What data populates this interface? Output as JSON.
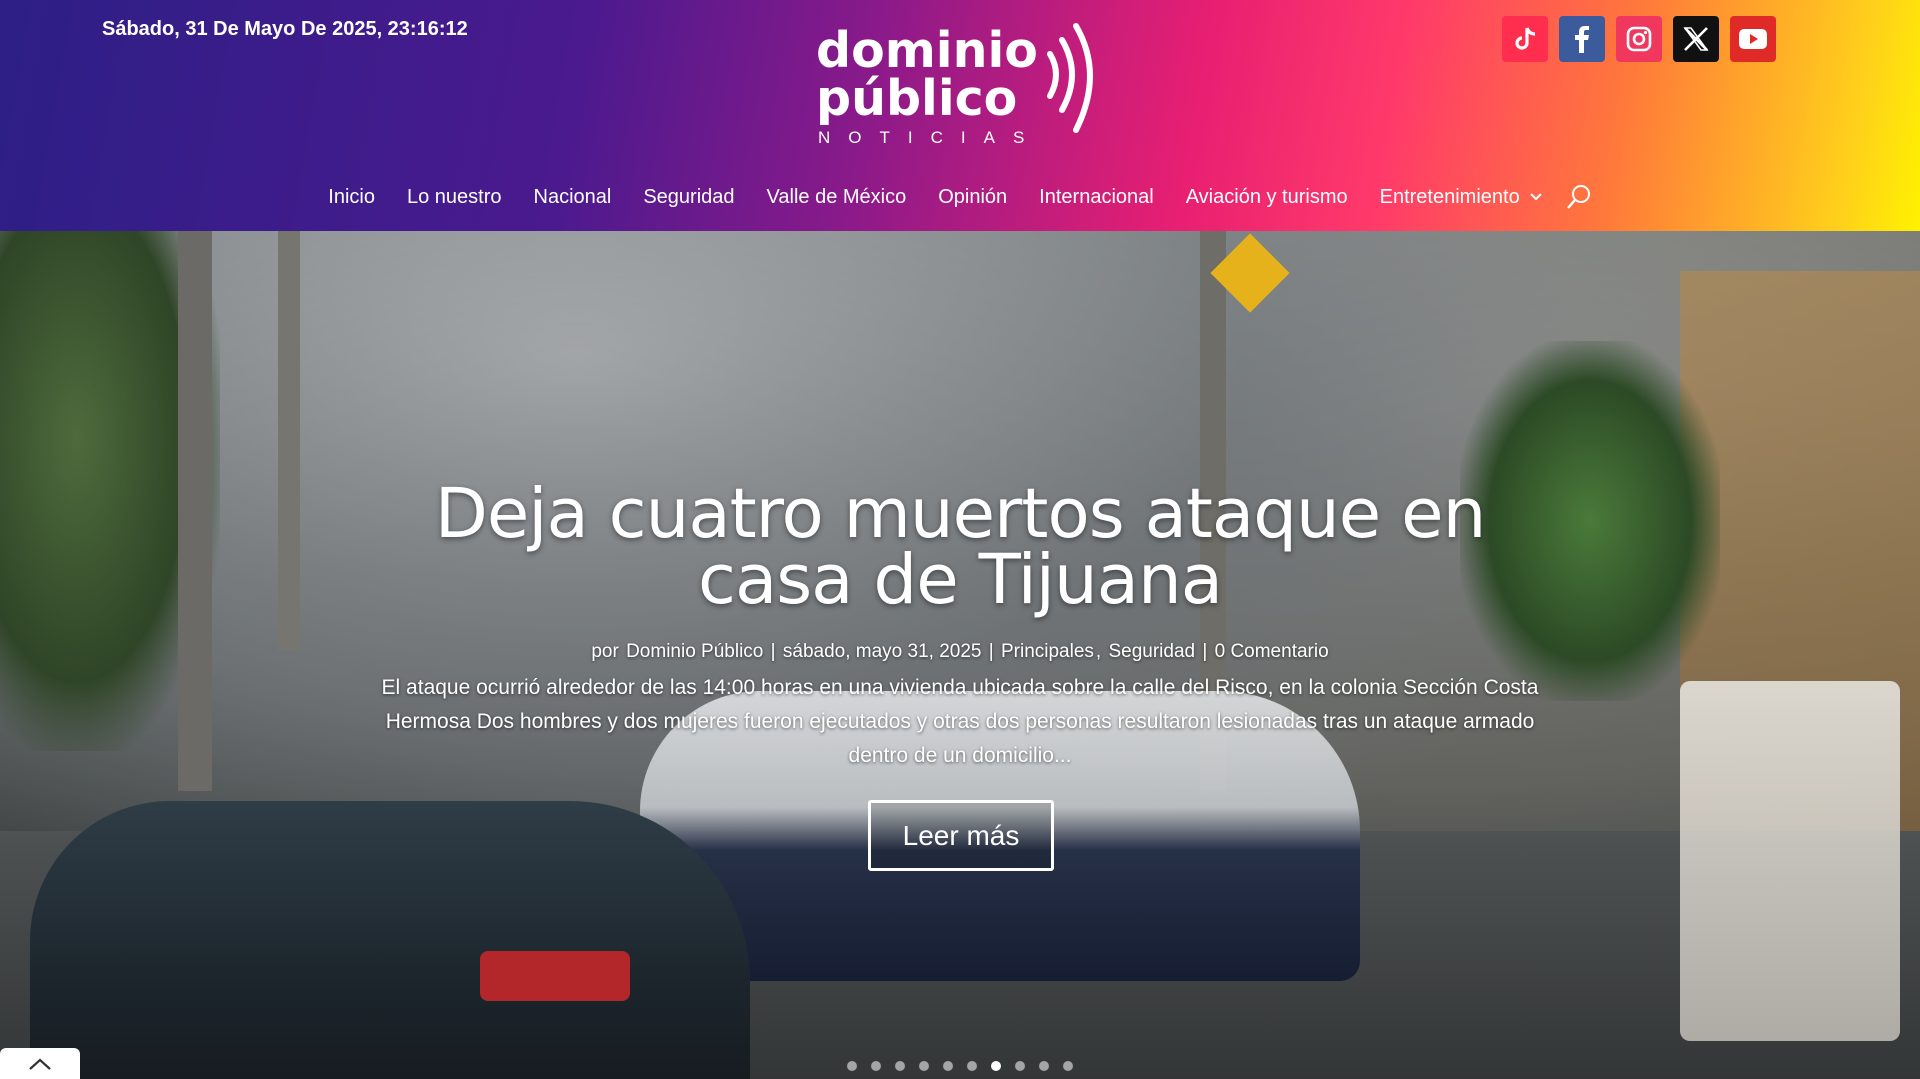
{
  "header": {
    "datetime": "Sábado, 31 De Mayo De 2025, 23:16:12",
    "logo": {
      "line1": "dominio",
      "line2": "público",
      "line3": "NOTICIAS"
    },
    "social": [
      {
        "name": "tiktok-icon"
      },
      {
        "name": "facebook-icon"
      },
      {
        "name": "instagram-icon"
      },
      {
        "name": "x-icon"
      },
      {
        "name": "youtube-icon"
      }
    ]
  },
  "nav": {
    "items": [
      "Inicio",
      "Lo nuestro",
      "Nacional",
      "Seguridad",
      "Valle de México",
      "Opinión",
      "Internacional",
      "Aviación y turismo",
      "Entretenimiento"
    ]
  },
  "hero": {
    "title": "Deja cuatro muertos ataque en casa de Tijuana",
    "meta": {
      "by": "por",
      "author": "Dominio Público",
      "date": "sábado, mayo 31, 2025",
      "cat1": "Principales",
      "cat2": "Seguridad",
      "comments": "0 Comentario"
    },
    "excerpt": "El ataque ocurrió alrededor de las 14:00 horas en una vivienda ubicada sobre la calle del Risco, en la colonia Sección Costa Hermosa Dos hombres y dos mujeres fueron ejecutados y otras dos personas resultaron lesionadas tras un ataque armado dentro de un domicilio...",
    "button": "Leer más",
    "slides_total": 10,
    "slide_active": 7
  },
  "colors": {
    "tiktok": "#ff2e4f",
    "facebook": "#3b5b9c",
    "instagram": "#f0385e",
    "x": "#111111",
    "youtube": "#e02a27"
  }
}
